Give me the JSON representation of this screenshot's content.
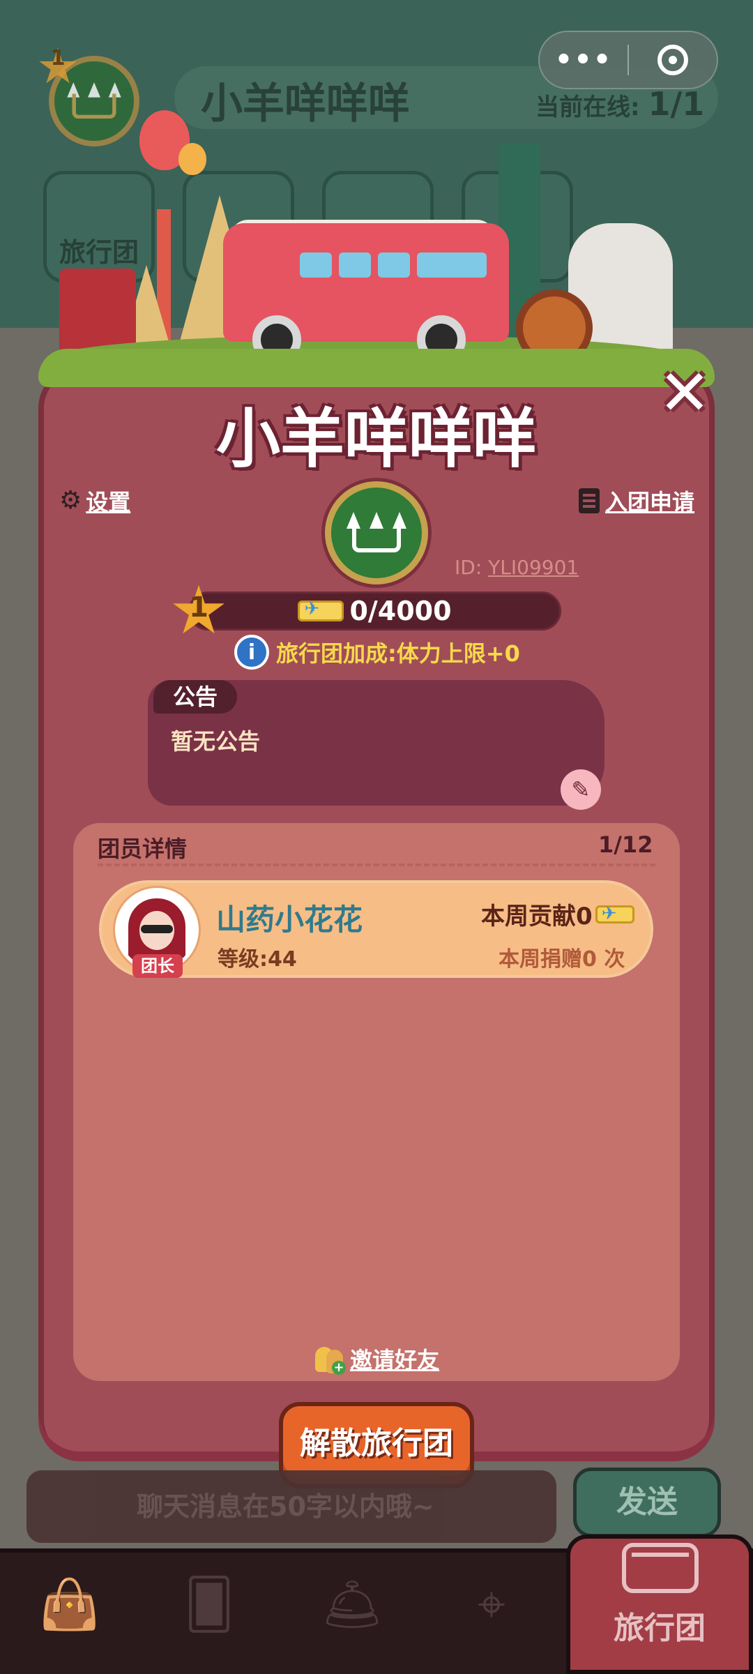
{
  "header": {
    "level": "1",
    "team_name": "小羊咩咩咩",
    "online_label": "当前在线:",
    "online_count": "1/1",
    "menu_tiles": [
      {
        "label": "旅行团"
      }
    ],
    "capsule": {
      "more": "•••"
    }
  },
  "dialog": {
    "title": "小羊咩咩咩",
    "settings_label": "设置",
    "apply_label": "入团申请",
    "team_id_prefix": "ID:",
    "team_id": "YLI09901",
    "level": "1",
    "exp_text": "0/4000",
    "exp_progress": 0,
    "bonus_text": "旅行团加成:体力上限+0",
    "notice": {
      "tab": "公告",
      "content": "暂无公告"
    },
    "members": {
      "header": "团员详情",
      "count": "1/12",
      "list": [
        {
          "name": "山药小花花",
          "level": "等级:44",
          "role": "团长",
          "weekly_contribution": "本周贡献0",
          "weekly_donation": "本周捐赠0 次"
        }
      ]
    },
    "invite_label": "邀请好友",
    "disband_label": "解散旅行团"
  },
  "chat": {
    "placeholder": "聊天消息在50字以内哦~",
    "send_label": "发送"
  },
  "tabbar": {
    "active_label": "旅行团"
  },
  "colors": {
    "dialog_bg": "#a14d58",
    "member_card": "#f7bd86",
    "accent_orange": "#e8652a",
    "bonus_yellow": "#f7d94a"
  }
}
